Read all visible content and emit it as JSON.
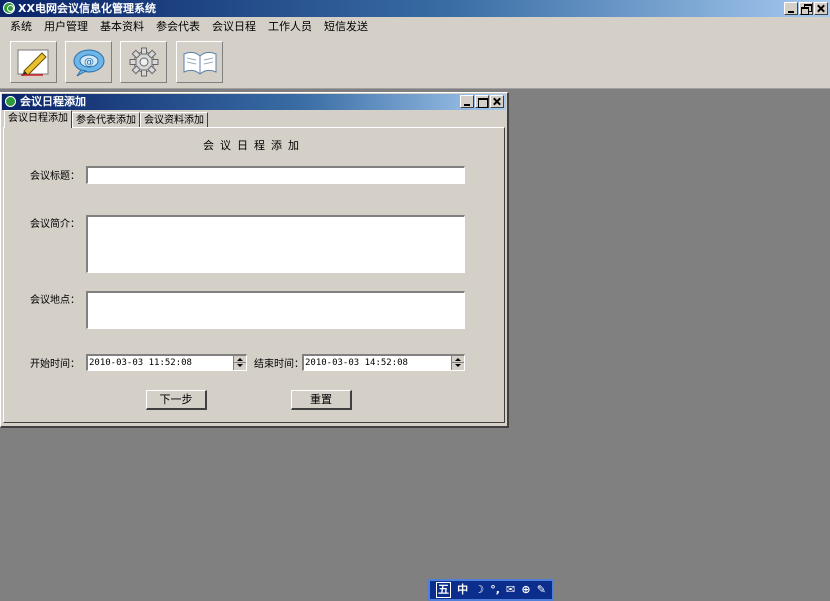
{
  "app": {
    "title": "XX电网会议信息化管理系统"
  },
  "menu": {
    "items": [
      "系统",
      "用户管理",
      "基本资料",
      "参会代表",
      "会议日程",
      "工作人员",
      "短信发送"
    ]
  },
  "toolbar": {
    "buttons": [
      {
        "icon": "pencil-icon"
      },
      {
        "icon": "chat-bubble-icon"
      },
      {
        "icon": "gear-icon"
      },
      {
        "icon": "open-book-icon"
      }
    ]
  },
  "dialog": {
    "title": "会议日程添加",
    "tabs": [
      "会议日程添加",
      "参会代表添加",
      "会议资料添加"
    ],
    "form": {
      "heading": "会议日程添加",
      "title_label": "会议标题：",
      "title_value": "",
      "intro_label": "会议简介：",
      "intro_value": "",
      "location_label": "会议地点：",
      "location_value": "",
      "start_label": "开始时间：",
      "start_value": "2010-03-03 11:52:08",
      "end_label": "结束时间：",
      "end_value": "2010-03-03 14:52:08",
      "next_button": "下一步",
      "reset_button": "重置"
    }
  },
  "ime": {
    "items": [
      "五",
      "中",
      "☽",
      "°,",
      "✉",
      "⊕",
      "✎"
    ]
  },
  "colors": {
    "desktop": "#808080",
    "chrome": "#d4d0c8",
    "titlebar_start": "#0a246a",
    "titlebar_end": "#a6caf0",
    "ime_bar": "#0b2d8c"
  }
}
